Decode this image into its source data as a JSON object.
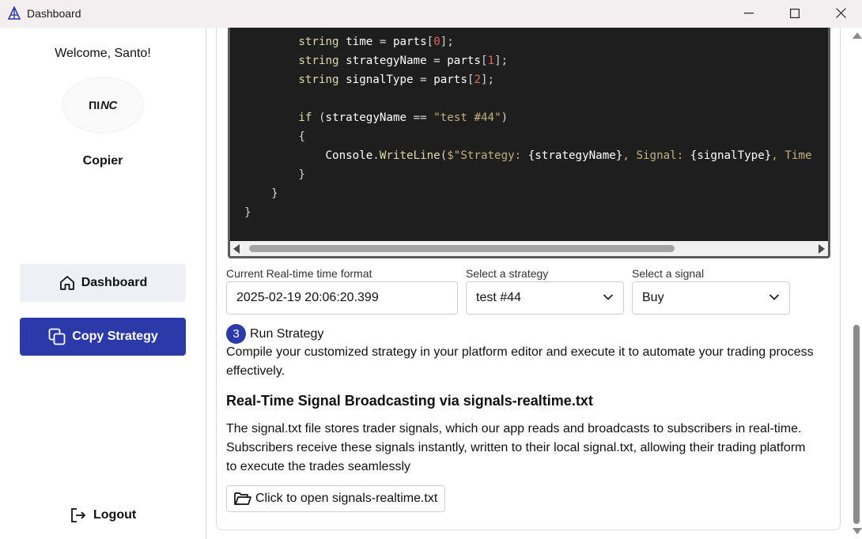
{
  "window": {
    "title": "Dashboard",
    "controls": {
      "minimize": "minimize-icon",
      "maximize": "maximize-icon",
      "close": "close-icon"
    }
  },
  "sidebar": {
    "welcome": "Welcome, Santo!",
    "logo_text": "NC",
    "app_name": "Copier",
    "nav": [
      {
        "label": "Dashboard",
        "icon": "home-icon",
        "active": false
      },
      {
        "label": "Copy Strategy",
        "icon": "copy-icon",
        "active": true
      }
    ],
    "logout_label": "Logout"
  },
  "code": {
    "lines": [
      "        string time = parts[0];",
      "        string strategyName = parts[1];",
      "        string signalType = parts[2];",
      "",
      "        if (strategyName == \"test #44\")",
      "        {",
      "            Console.WriteLine($\"Strategy: {strategyName}, Signal: {signalType}, Time",
      "        }",
      "    }",
      "}"
    ]
  },
  "form": {
    "time_format_label": "Current Real-time time format",
    "time_format_value": "2025-02-19 20:06:20.399",
    "strategy_label": "Select a strategy",
    "strategy_value": "test #44",
    "signal_label": "Select a signal",
    "signal_value": "Buy"
  },
  "step3": {
    "number": "3",
    "title": "Run Strategy",
    "description": "Compile your customized strategy in your platform editor and execute it to automate your trading process effectively."
  },
  "broadcast": {
    "heading": "Real-Time Signal Broadcasting via signals-realtime.txt",
    "description": "The signal.txt file stores trader signals, which our app reads and broadcasts to subscribers in real-time. Subscribers receive these signals instantly, written to their local signal.txt, allowing their trading platform to execute the trades seamlessly",
    "open_button": "Click to open signals-realtime.txt"
  },
  "colors": {
    "accent": "#2b3aa8",
    "code_bg": "#1e1e1e",
    "nav_inactive_bg": "#eef0f5"
  }
}
